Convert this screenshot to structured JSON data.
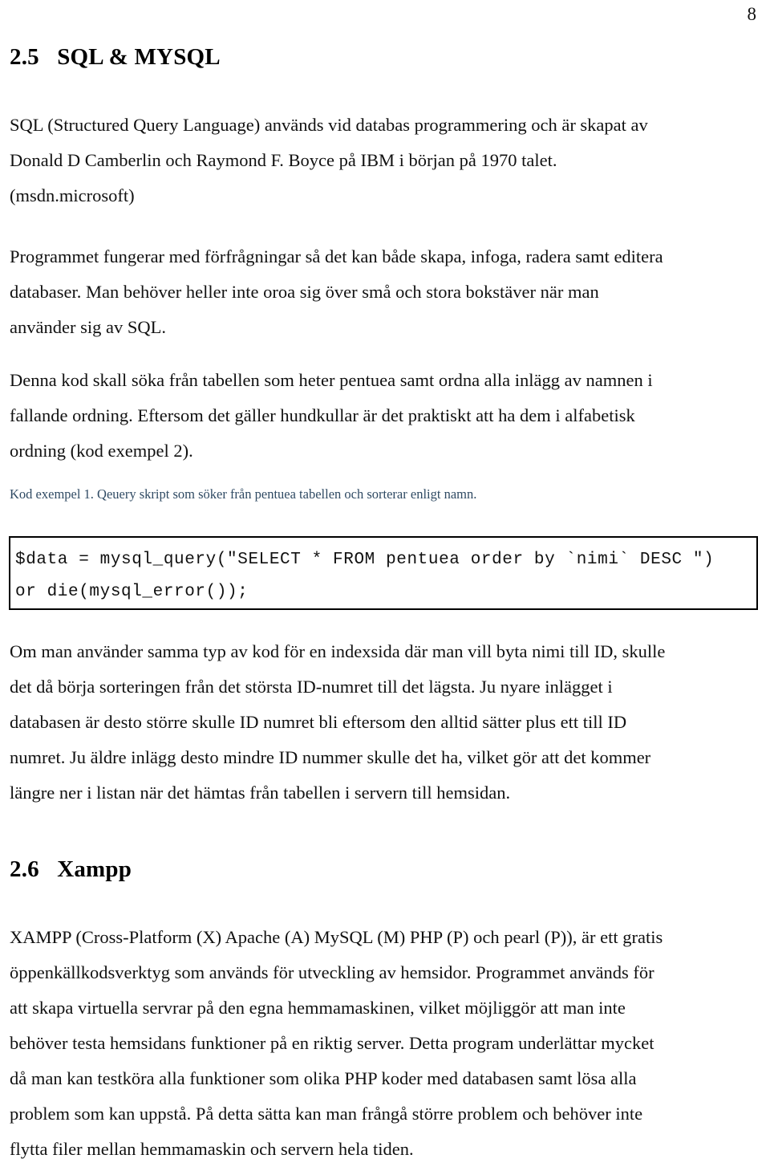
{
  "document": {
    "page_number": "8",
    "sections": [
      {
        "number": "2.5",
        "title": "SQL & MYSQL",
        "heading_text": "2.5   SQL & MYSQL"
      },
      {
        "number": "2.6",
        "title": "Xampp",
        "heading_text": "2.6   Xampp"
      }
    ],
    "paragraphs": {
      "intro": {
        "lines": [
          "SQL (Structured Query Language) används vid databas programmering och är skapat av",
          "Donald D Camberlin och Raymond F. Boyce på IBM i början på 1970 talet."
        ]
      },
      "source": {
        "lines": [
          "(msdn.microsoft)"
        ]
      },
      "program": {
        "lines": [
          "Programmet fungerar med förfrågningar så det kan både skapa, infoga, radera samt editera",
          "databaser. Man behöver heller inte oroa sig över små och stora bokstäver när man",
          "använder sig av SQL."
        ]
      },
      "denna": {
        "lines": [
          "Denna kod skall söka från tabellen som heter pentuea samt ordna alla inlägg av namnen i",
          "fallande ordning. Eftersom det gäller hundkullar är det praktiskt att ha dem i alfabetisk",
          "ordning (kod exempel 2)."
        ]
      },
      "om_man": {
        "lines": [
          "Om man använder samma typ av kod för en indexsida där man vill byta nimi till ID, skulle",
          "det då börja sorteringen från det största ID-numret till det lägsta. Ju nyare inlägget i",
          "databasen är desto större skulle ID numret bli eftersom den alltid sätter plus ett till ID",
          "numret. Ju äldre inlägg desto mindre ID nummer skulle det ha, vilket gör att det kommer",
          "längre ner i listan när det hämtas från tabellen i servern till hemsidan."
        ]
      },
      "xampp_1": {
        "lines": [
          "XAMPP (Cross-Platform (X) Apache (A) MySQL (M) PHP (P) och pearl (P)), är ett gratis",
          "öppenkällkodsverktyg som används för utveckling av hemsidor. Programmet används för"
        ]
      },
      "xampp_2": {
        "lines": [
          "att skapa virtuella servrar på den egna hemmamaskinen, vilket möjliggör att man inte",
          "behöver testa hemsidans funktioner på en riktig server. Detta program underlättar mycket",
          "då man kan testköra alla funktioner som olika PHP koder med databasen samt lösa alla",
          "problem som kan uppstå. På detta sätta kan man frångå större problem och behöver inte",
          "flytta filer mellan hemmamaskin och servern hela tiden."
        ]
      }
    },
    "caption": "Kod exempel 1. Qeuery skript som söker från pentuea tabellen och sorterar enligt namn.",
    "code_block": {
      "lines": [
        "$data = mysql_query(\"SELECT * FROM pentuea order by `nimi` DESC \")",
        "or die(mysql_error());"
      ]
    },
    "colors": {
      "text": "#111111",
      "caption": "#2f4a63",
      "code_border": "#000000",
      "background": "#ffffff"
    }
  }
}
